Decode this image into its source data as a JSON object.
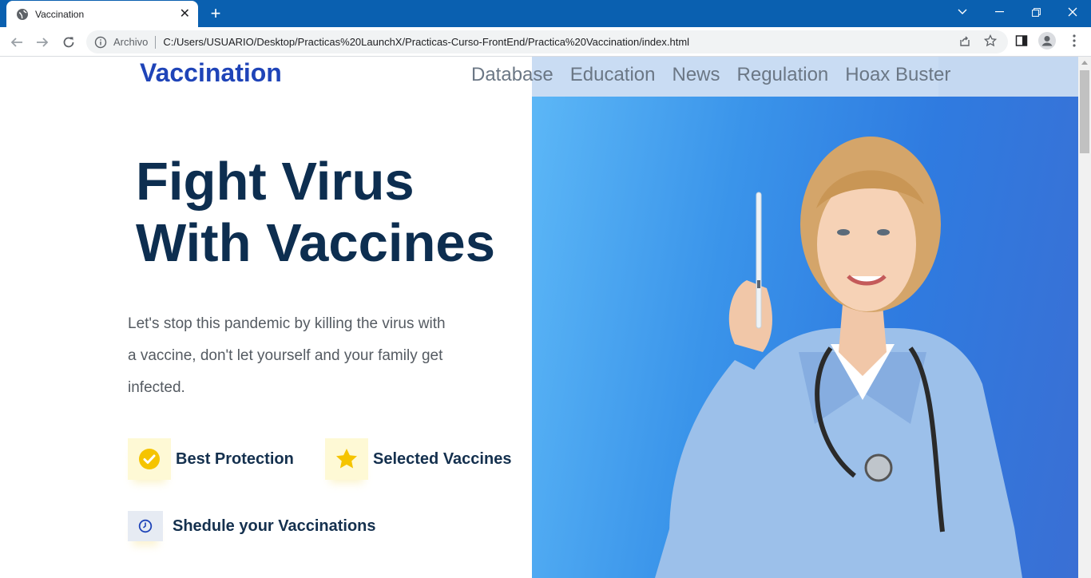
{
  "browser": {
    "tab_title": "Vaccination",
    "new_tab_label": "+",
    "tab_close_label": "✕",
    "scheme_label": "Archivo",
    "url": "C:/Users/USUARIO/Desktop/Practicas%20LaunchX/Practicas-Curso-FrontEnd/Practica%20Vaccination/index.html"
  },
  "site": {
    "brand": "Vaccination",
    "nav": [
      "Database",
      "Education",
      "News",
      "Regulation",
      "Hoax Buster"
    ]
  },
  "hero": {
    "headline_line1": "Fight Virus",
    "headline_line2": "With Vaccines",
    "lead": "Let's stop this pandemic by killing the virus with a vaccine, don't let yourself and your family get infected.",
    "features": [
      {
        "label": "Best Protection",
        "icon": "check-circle-icon"
      },
      {
        "label": "Selected Vaccines",
        "icon": "star-icon"
      },
      {
        "label": "Shedule your Vaccinations",
        "icon": "clock-icon"
      }
    ]
  },
  "colors": {
    "titlebar": "#0a60b0",
    "brand": "#1f44b8",
    "headline": "#0d2e50",
    "hero_blue": "#3a94ea",
    "feature_icon": "#f5c400"
  }
}
